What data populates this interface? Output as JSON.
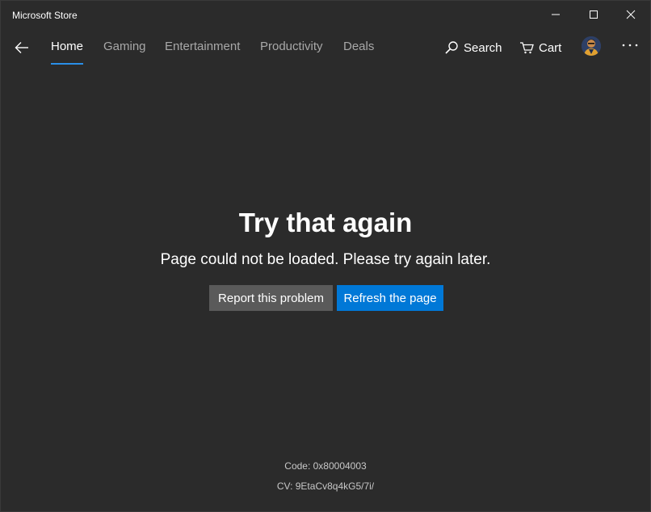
{
  "window": {
    "title": "Microsoft Store"
  },
  "nav": {
    "tabs": [
      {
        "label": "Home",
        "active": true
      },
      {
        "label": "Gaming",
        "active": false
      },
      {
        "label": "Entertainment",
        "active": false
      },
      {
        "label": "Productivity",
        "active": false
      },
      {
        "label": "Deals",
        "active": false
      }
    ],
    "search_label": "Search",
    "cart_label": "Cart"
  },
  "error": {
    "title": "Try that again",
    "message": "Page could not be loaded. Please try again later.",
    "report_label": "Report this problem",
    "refresh_label": "Refresh the page",
    "code": "Code: 0x80004003",
    "cv": "CV: 9EtaCv8q4kG5/7i/"
  },
  "colors": {
    "background": "#2b2b2b",
    "accent": "#0078d7",
    "tab_indicator": "#2a8fe8",
    "secondary_button": "#5a5a5a"
  },
  "icons": {
    "back": "arrow-left-icon",
    "search": "search-icon",
    "cart": "cart-icon",
    "more": "more-dots-icon",
    "minimize": "minimize-icon",
    "maximize": "maximize-icon",
    "close": "close-icon"
  }
}
